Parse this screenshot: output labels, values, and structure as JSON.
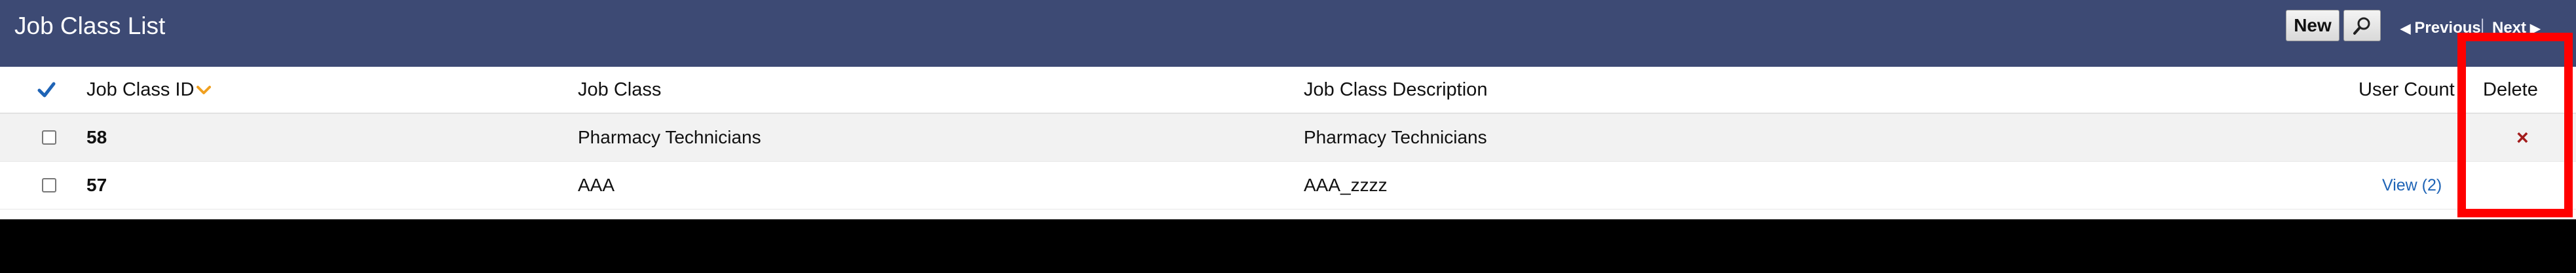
{
  "header": {
    "title": "Job Class List",
    "new_label": "New",
    "search_icon": "magnifier-icon",
    "previous_label": "Previous",
    "next_label": "Next",
    "separator": "|"
  },
  "table": {
    "columns": {
      "id": "Job Class ID",
      "job_class": "Job Class",
      "description": "Job Class Description",
      "user_count": "User Count",
      "delete": "Delete"
    },
    "sort": {
      "column": "Job Class ID",
      "direction": "descending"
    },
    "rows": [
      {
        "id": "58",
        "job_class": "Pharmacy Technicians",
        "description": "Pharmacy Technicians",
        "user_count": "",
        "delete": "×"
      },
      {
        "id": "57",
        "job_class": "AAA",
        "description": "AAA_zzzz",
        "user_count": "View (2)",
        "delete": ""
      }
    ]
  },
  "colors": {
    "header_bg": "#3d4a74",
    "link": "#1f64b6",
    "delete_icon": "#a31c1c",
    "sort_arrow": "#f0a020",
    "highlight": "#ff0000"
  }
}
